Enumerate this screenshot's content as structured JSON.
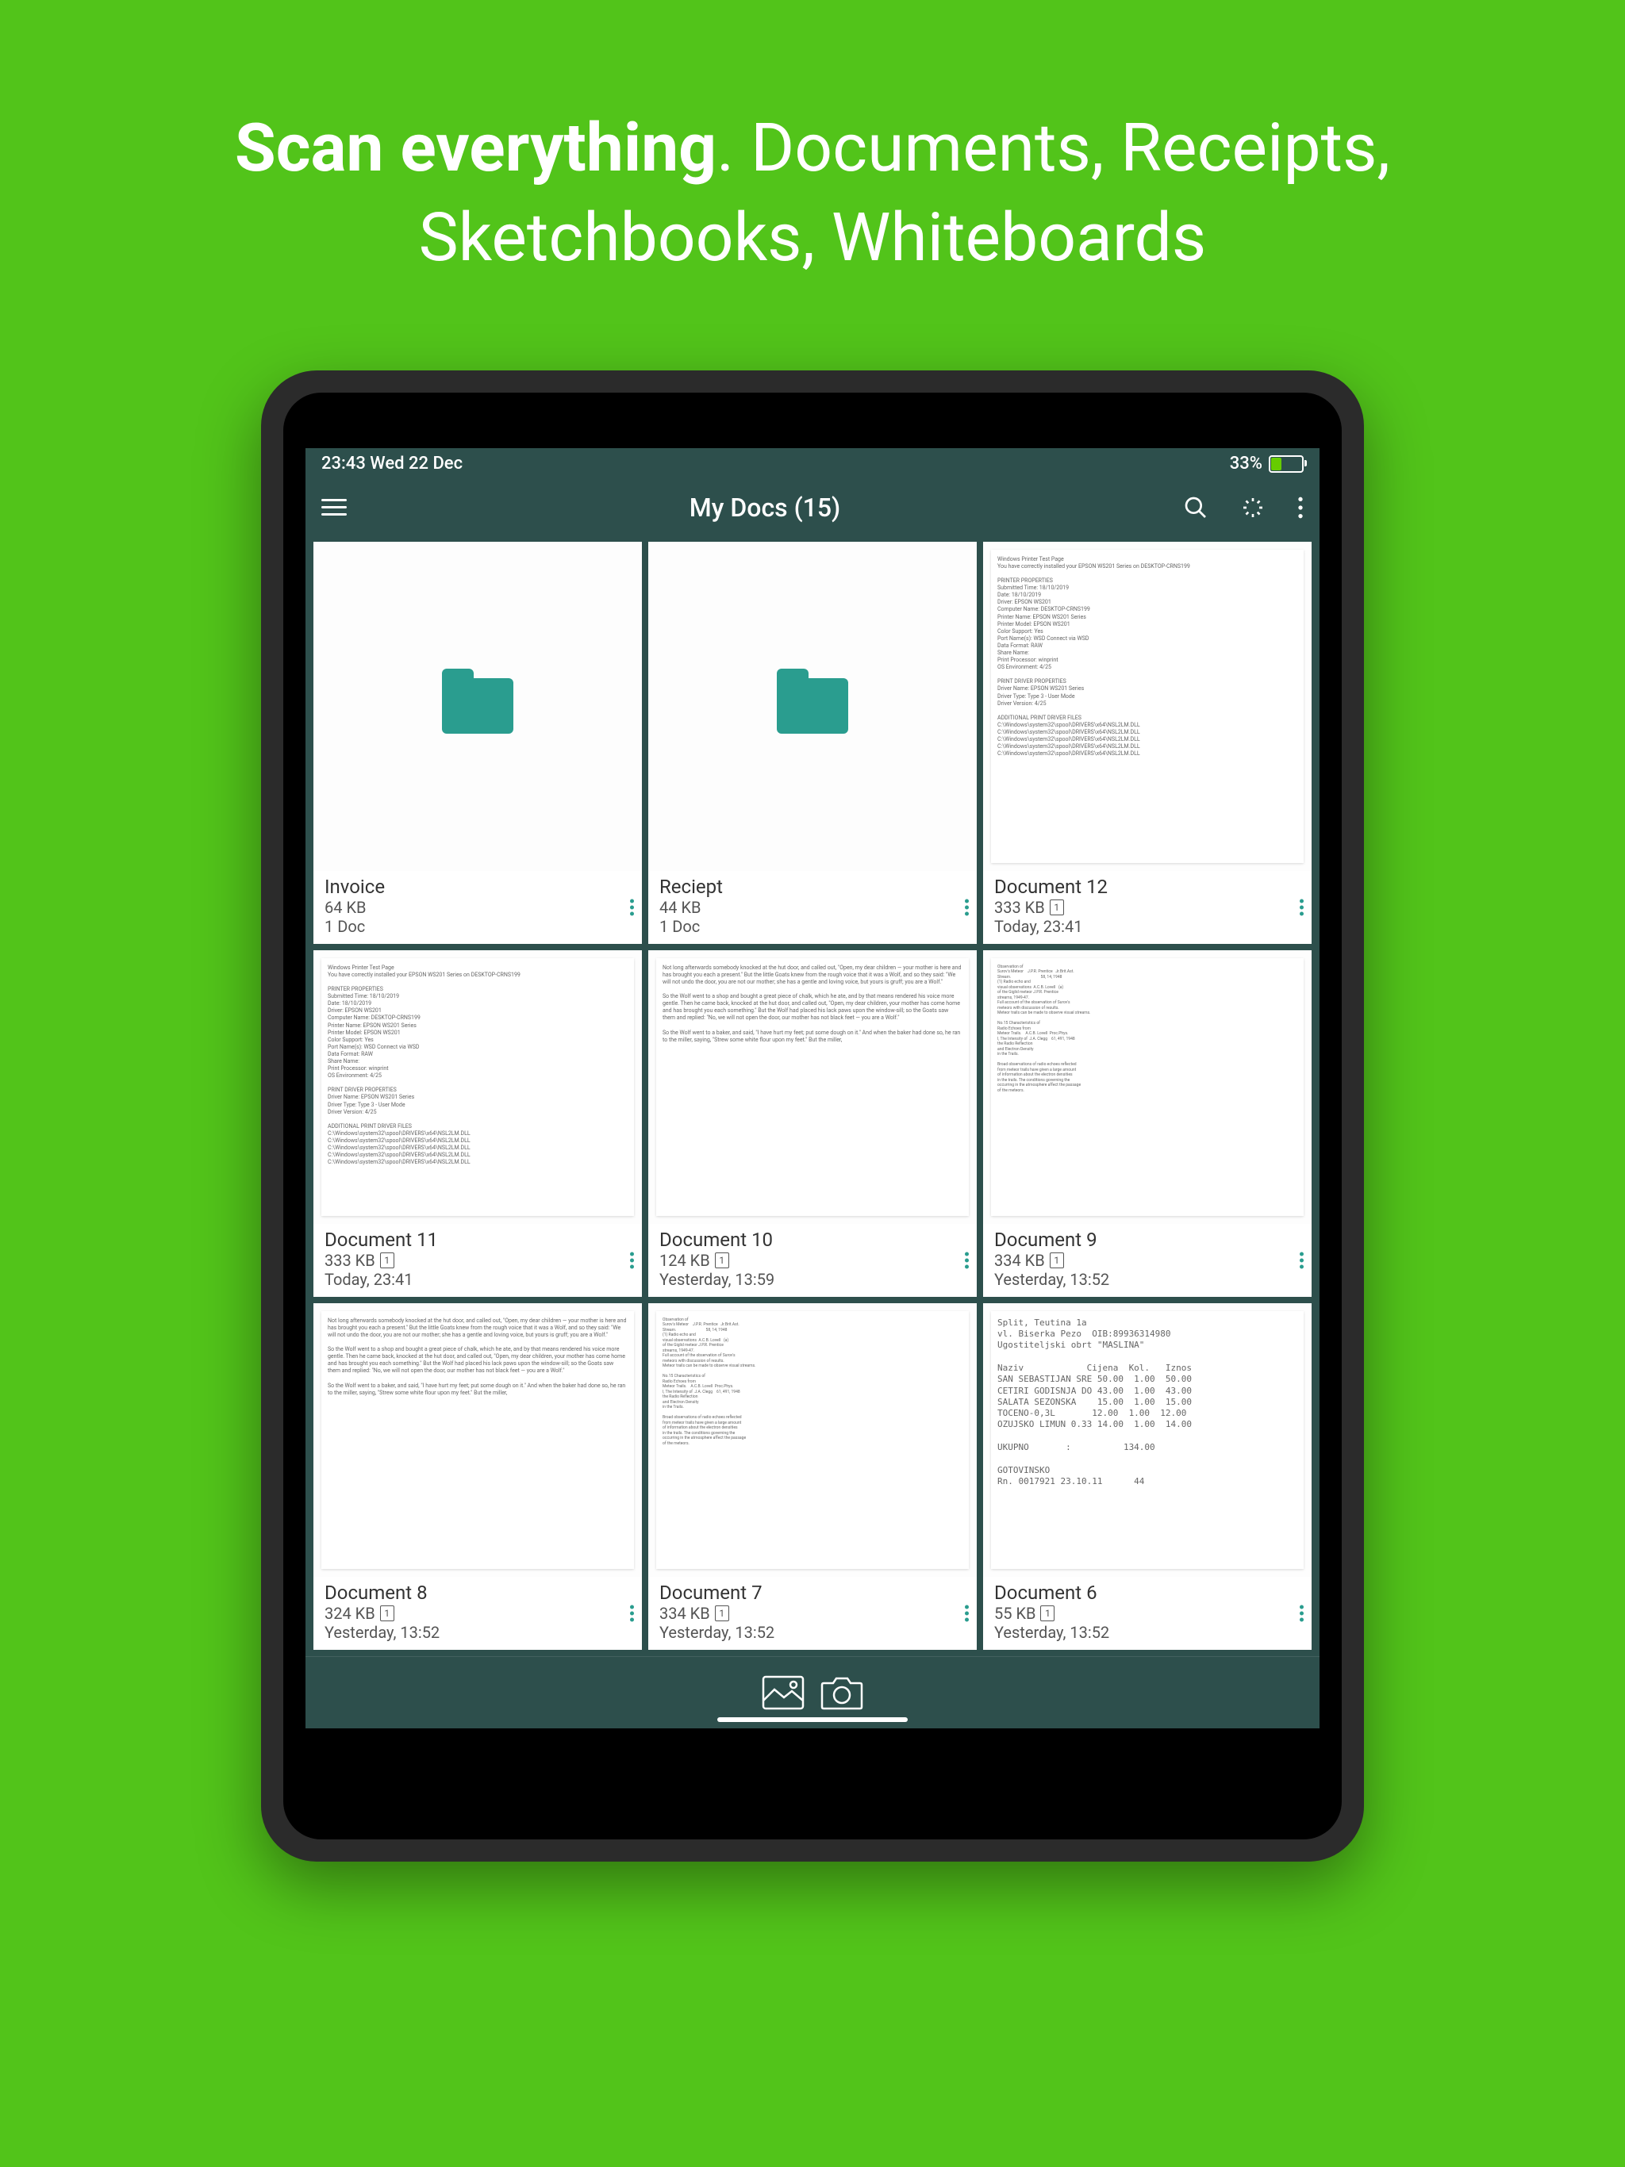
{
  "hero": {
    "bold": "Scan everything",
    "rest": ". Documents, Receipts, Sketchbooks, Whiteboards"
  },
  "status": {
    "time_date": "23:43  Wed 22 Dec",
    "battery_pct": "33%"
  },
  "header": {
    "title": "My Docs (15)"
  },
  "tiles": [
    {
      "type": "folder",
      "title": "Invoice",
      "sub": "64 KB",
      "date": "1 Doc"
    },
    {
      "type": "folder",
      "title": "Reciept",
      "sub": "44 KB",
      "date": "1 Doc"
    },
    {
      "type": "doc",
      "thumb": "printer",
      "title": "Document 12",
      "sub": "333 KB",
      "pages": "1",
      "date": "Today, 23:41"
    },
    {
      "type": "doc",
      "thumb": "printer",
      "title": "Document 11",
      "sub": "333 KB",
      "pages": "1",
      "date": "Today, 23:41"
    },
    {
      "type": "doc",
      "thumb": "text1",
      "title": "Document 10",
      "sub": "124 KB",
      "pages": "1",
      "date": "Yesterday, 13:59"
    },
    {
      "type": "doc",
      "thumb": "dense",
      "title": "Document 9",
      "sub": "334 KB",
      "pages": "1",
      "date": "Yesterday, 13:52"
    },
    {
      "type": "doc",
      "thumb": "text1",
      "title": "Document 8",
      "sub": "324 KB",
      "pages": "1",
      "date": "Yesterday, 13:52"
    },
    {
      "type": "doc",
      "thumb": "dense",
      "title": "Document 7",
      "sub": "334 KB",
      "pages": "1",
      "date": "Yesterday, 13:52"
    },
    {
      "type": "doc",
      "thumb": "receipt",
      "title": "Document 6",
      "sub": "55 KB",
      "pages": "1",
      "date": "Yesterday, 13:52"
    }
  ],
  "thumbs": {
    "printer": "Windows Printer Test Page\nYou have correctly installed your EPSON WS201 Series on DESKTOP-CRNS199\n\nPRINTER PROPERTIES\nSubmitted Time: 18/10/2019\nDate: 18/10/2019\nDriver: EPSON WS201\nComputer Name: DESKTOP-CRNS199\nPrinter Name: EPSON WS201 Series\nPrinter Model: EPSON WS201\nColor Support: Yes\nPort Name(s): WSD Connect via WSD\nData Format: RAW\nShare Name:\nPrint Processor: winprint\nOS Environment: 4/25\n\nPRINT DRIVER PROPERTIES\nDriver Name: EPSON WS201 Series\nDriver Type: Type 3 - User Mode\nDriver Version: 4/25\n\nADDITIONAL PRINT DRIVER FILES\nC:\\Windows\\system32\\spool\\DRIVERS\\x64\\NSL2LM.DLL\nC:\\Windows\\system32\\spool\\DRIVERS\\x64\\NSL2LM.DLL\nC:\\Windows\\system32\\spool\\DRIVERS\\x64\\NSL2LM.DLL\nC:\\Windows\\system32\\spool\\DRIVERS\\x64\\NSL2LM.DLL\nC:\\Windows\\system32\\spool\\DRIVERS\\x64\\NSL2LM.DLL",
    "text1": "Not long afterwards somebody knocked at the hut door, and called out, \"Open, my dear children — your mother is here and has brought you each a present.\" But the little Goats knew from the rough voice that it was a Wolf, and so they said: \"We will not undo the door, you are not our mother; she has a gentle and loving voice, but yours is gruff; you are a Wolf.\"\n\nSo the Wolf went to a shop and bought a great piece of chalk, which he ate, and by that means rendered his voice more gentle. Then he came back, knocked at the hut door, and called out, \"Open, my dear children, your mother has come home and has brought you each something.\" But the Wolf had placed his lack paws upon the window-sill; so the Goats saw them and replied: \"No, we will not open the door, our mother has not black feet — you are a Wolf.\"\n\nSo the Wolf went to a baker, and said, \"I have hurt my feet; put some dough on it.\" And when the baker had done so, he ran to the miller, saying, \"Strew some white flour upon my feet.\" But the miller,",
    "dense": "Observation of\nSurov's Meteor    J.P.R. Prentice   Jr.Brit.Ast.\nStream.                              58, 14, 1948\n(1) Radio echo and\nvisual observations  A.C.B. Lovell   (a)\nof the Giglid meteor J.P.R. Prentice\nstreams, 1949-47.\nFull account of the observation of Surov's\nmeteors with discussion of results.\nMeteor trails can be made to observe visual streams.\n\nNo.15 Characteristics of\nRadio Echoes from\nMeteor Trails.    A.C.B. Lovell  Proc.Phys.\nI, The Intensity of  J.A. Clegg    61, 491, 1948\nthe Radio Reflection\nand Electron Density\nin the Trails.\n\nBroad observations of radio echoes reflected\nfrom meteor trails have given a large amount\nof information about the electron densities\nin the trails. The conditions governing the\noccurring in the atmosphere affect the passage\nof the meteors.",
    "receipt": "Split, Teutina 1a\nvl. Biserka Pezo  OIB:89936314980\nUgostiteljski obrt \"MASLINA\"\n\nNaziv            Cijena  Kol.   Iznos\nSAN SEBASTIJAN SRE 50.00  1.00  50.00\nCETIRI GODISNJA DO 43.00  1.00  43.00\nSALATA SEZONSKA    15.00  1.00  15.00\nTOCENO-0,3L       12.00  1.00  12.00\nOZUJSKO LIMUN 0.33 14.00  1.00  14.00\n\nUKUPNO       :          134.00\n\nGOTOVINSKO\nRn. 0017921 23.10.11      44"
  }
}
